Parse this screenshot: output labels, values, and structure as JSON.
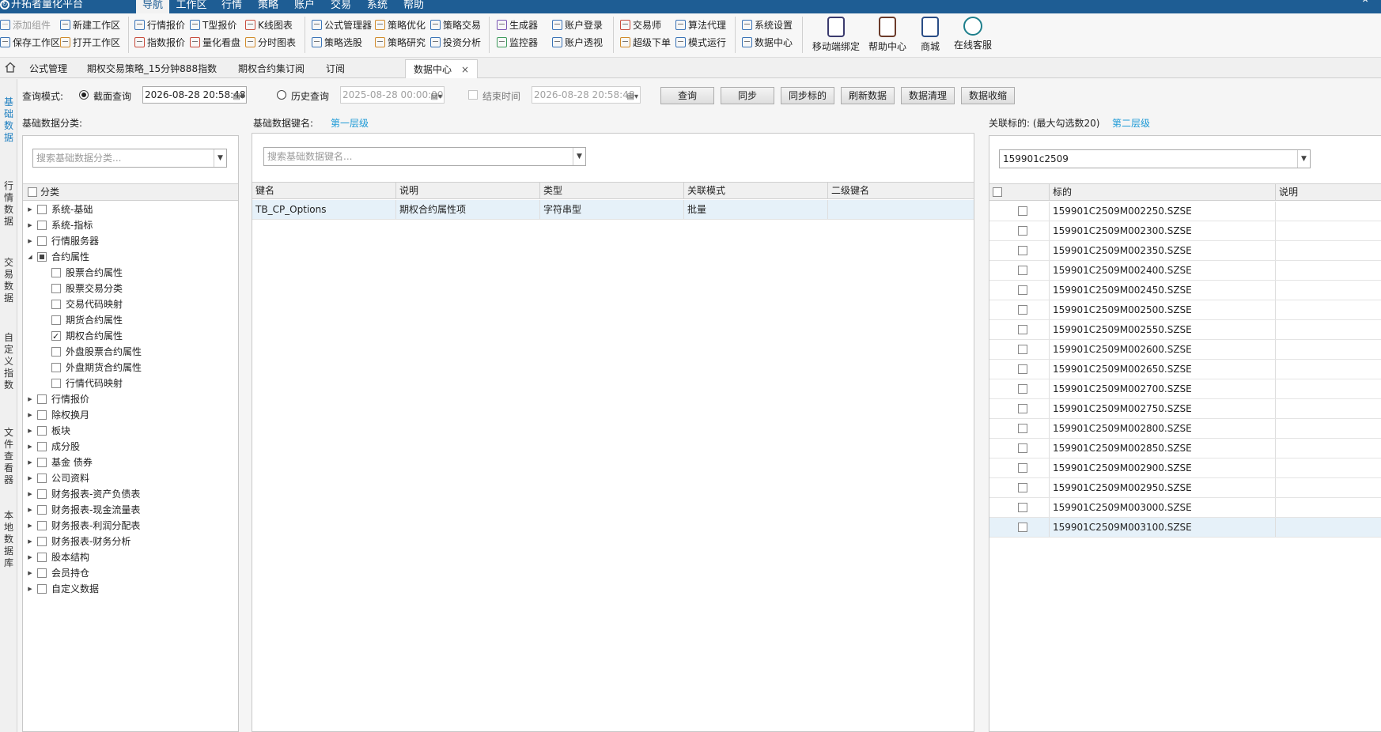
{
  "app": {
    "title": "开拓者量化平台",
    "logo_icon": "app-logo-icon"
  },
  "menus": [
    "导航",
    "工作区",
    "行情",
    "策略",
    "账户",
    "交易",
    "系统",
    "帮助"
  ],
  "ribbon": {
    "col1": [
      "添加组件",
      "保存工作区"
    ],
    "col2": [
      "新建工作区",
      "打开工作区"
    ],
    "col3": [
      "行情报价",
      "指数报价"
    ],
    "col4": [
      "T型报价",
      "量化看盘"
    ],
    "col5": [
      "K线图表",
      "分时图表"
    ],
    "col6": [
      "公式管理器",
      "策略选股"
    ],
    "col7": [
      "策略优化",
      "策略研究"
    ],
    "col8": [
      "策略交易",
      "投资分析"
    ],
    "col9": [
      "生成器",
      "监控器"
    ],
    "col10": [
      "账户登录",
      "账户透视"
    ],
    "col11": [
      "交易师",
      "超级下单"
    ],
    "col12": [
      "算法代理",
      "模式运行"
    ],
    "col13": [
      "系统设置",
      "数据中心"
    ],
    "big": [
      "移动端绑定",
      "帮助中心",
      "商城",
      "在线客服"
    ]
  },
  "tabs": [
    "公式管理",
    "期权交易策略_15分钟888指数",
    "期权合约集订阅",
    "订阅",
    "数据中心"
  ],
  "tab_close": "×",
  "rail": [
    "基础数据",
    "行情数据",
    "交易数据",
    "自定义指数",
    "文件查看器",
    "本地数据库"
  ],
  "query": {
    "mode_label": "查询模式:",
    "snapshot_label": "截面查询",
    "snapshot_time": "2026-08-28 20:58:48",
    "history_label": "历史查询",
    "history_start": "2025-08-28 00:00:00",
    "end_label": "结束时间",
    "history_end": "2026-08-28 20:58:48",
    "buttons": [
      "查询",
      "同步",
      "同步标的",
      "刷新数据",
      "数据清理",
      "数据收缩"
    ]
  },
  "left": {
    "title": "基础数据分类:",
    "search_placeholder": "搜索基础数据分类...",
    "header": "分类",
    "tree": [
      {
        "label": "系统-基础",
        "level": 0,
        "expander": "▶",
        "state": ""
      },
      {
        "label": "系统-指标",
        "level": 0,
        "expander": "▶",
        "state": ""
      },
      {
        "label": "行情服务器",
        "level": 0,
        "expander": "▶",
        "state": ""
      },
      {
        "label": "合约属性",
        "level": 0,
        "expander": "◢",
        "state": "part"
      },
      {
        "label": "股票合约属性",
        "level": 1,
        "expander": "",
        "state": ""
      },
      {
        "label": "股票交易分类",
        "level": 1,
        "expander": "",
        "state": ""
      },
      {
        "label": "交易代码映射",
        "level": 1,
        "expander": "",
        "state": ""
      },
      {
        "label": "期货合约属性",
        "level": 1,
        "expander": "",
        "state": ""
      },
      {
        "label": "期权合约属性",
        "level": 1,
        "expander": "",
        "state": "chk"
      },
      {
        "label": "外盘股票合约属性",
        "level": 1,
        "expander": "",
        "state": ""
      },
      {
        "label": "外盘期货合约属性",
        "level": 1,
        "expander": "",
        "state": ""
      },
      {
        "label": "行情代码映射",
        "level": 1,
        "expander": "",
        "state": ""
      },
      {
        "label": "行情报价",
        "level": 0,
        "expander": "▶",
        "state": ""
      },
      {
        "label": "除权换月",
        "level": 0,
        "expander": "▶",
        "state": ""
      },
      {
        "label": "板块",
        "level": 0,
        "expander": "▶",
        "state": ""
      },
      {
        "label": "成分股",
        "level": 0,
        "expander": "▶",
        "state": ""
      },
      {
        "label": "基金 债券",
        "level": 0,
        "expander": "▶",
        "state": ""
      },
      {
        "label": "公司资料",
        "level": 0,
        "expander": "▶",
        "state": ""
      },
      {
        "label": "财务报表-资产负债表",
        "level": 0,
        "expander": "▶",
        "state": ""
      },
      {
        "label": "财务报表-现金流量表",
        "level": 0,
        "expander": "▶",
        "state": ""
      },
      {
        "label": "财务报表-利润分配表",
        "level": 0,
        "expander": "▶",
        "state": ""
      },
      {
        "label": "财务报表-财务分析",
        "level": 0,
        "expander": "▶",
        "state": ""
      },
      {
        "label": "股本结构",
        "level": 0,
        "expander": "▶",
        "state": ""
      },
      {
        "label": "会员持仓",
        "level": 0,
        "expander": "▶",
        "state": ""
      },
      {
        "label": "自定义数据",
        "level": 0,
        "expander": "▶",
        "state": ""
      }
    ]
  },
  "middle": {
    "title": "基础数据键名:",
    "level": "第一层级",
    "search_placeholder": "搜索基础数据键名...",
    "columns": [
      "键名",
      "说明",
      "类型",
      "关联模式",
      "二级键名"
    ],
    "rows": [
      [
        "TB_CP_Options",
        "期权合约属性项",
        "字符串型",
        "批量",
        ""
      ]
    ]
  },
  "right": {
    "title": "关联标的: (最大勾选数20)",
    "level": "第二层级",
    "search_value": "159901c2509",
    "columns": [
      "标的",
      "说明"
    ],
    "rows": [
      "159901C2509M002250.SZSE",
      "159901C2509M002300.SZSE",
      "159901C2509M002350.SZSE",
      "159901C2509M002400.SZSE",
      "159901C2509M002450.SZSE",
      "159901C2509M002500.SZSE",
      "159901C2509M002550.SZSE",
      "159901C2509M002600.SZSE",
      "159901C2509M002650.SZSE",
      "159901C2509M002700.SZSE",
      "159901C2509M002750.SZSE",
      "159901C2509M002800.SZSE",
      "159901C2509M002850.SZSE",
      "159901C2509M002900.SZSE",
      "159901C2509M002950.SZSE",
      "159901C2509M003000.SZSE",
      "159901C2509M003100.SZSE"
    ]
  },
  "colors": {
    "titlebar": "#1e5d94",
    "accent": "#1e9ad6",
    "selected_row": "#e6f1f9"
  }
}
